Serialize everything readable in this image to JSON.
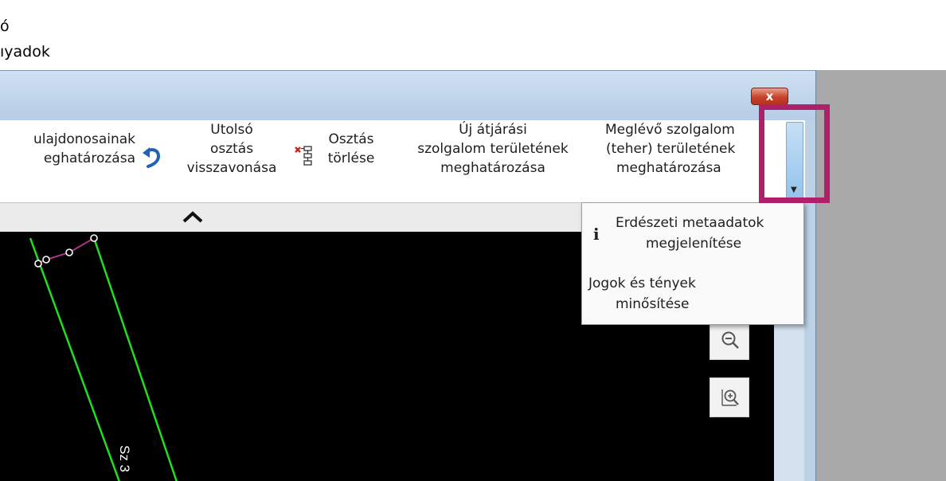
{
  "background": {
    "line1": "ó",
    "line2": "ıyadok"
  },
  "window": {
    "close_label": "x"
  },
  "ribbon": {
    "owners": [
      "ulajdonosainak",
      "eghatározása"
    ],
    "undo_split": [
      "Utolsó",
      "osztás",
      "visszavonása"
    ],
    "delete_split": [
      "Osztás",
      "törlése"
    ],
    "new_passage": [
      "Új átjárási",
      "szolgalom területének",
      "meghatározása"
    ],
    "existing_servitude": [
      "Meglévő szolgalom",
      "(teher) területének",
      "meghatározása"
    ]
  },
  "dropdown": {
    "info_glyph": "i",
    "item1": [
      "Erdészeti metaadatok",
      "megjelenítése"
    ],
    "item2": [
      "Jogok és tények",
      "minősítése"
    ]
  },
  "map": {
    "parcel_label": "Sz 3"
  },
  "colors": {
    "highlight": "#b01f6a",
    "parcel_line": "#22dd22",
    "vertex_line": "#c0309a",
    "close_red": "#c7432b"
  }
}
